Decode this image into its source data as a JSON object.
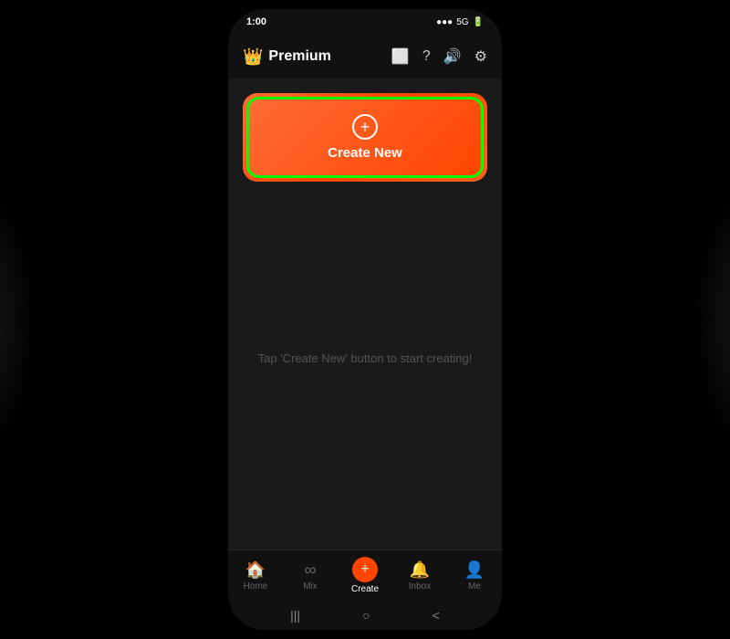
{
  "status_bar": {
    "time": "1:00",
    "right_info": "5G"
  },
  "header": {
    "crown_icon": "👑",
    "title": "Premium",
    "icons": {
      "monitor": "monitor-icon",
      "help": "help-icon",
      "volume": "volume-icon",
      "settings": "settings-icon"
    }
  },
  "create_button": {
    "label": "Create New",
    "plus_symbol": "+"
  },
  "empty_state": {
    "message": "Tap 'Create New' button to start creating!"
  },
  "bottom_nav": {
    "items": [
      {
        "label": "Home",
        "icon": "🏠",
        "active": false
      },
      {
        "label": "Mix",
        "icon": "∞",
        "active": false
      },
      {
        "label": "Create",
        "icon": "+",
        "active": true
      },
      {
        "label": "Inbox",
        "icon": "🔔",
        "active": false
      },
      {
        "label": "Me",
        "icon": "👤",
        "active": false
      }
    ]
  },
  "android_nav": {
    "menu_icon": "|||",
    "home_icon": "○",
    "back_icon": "<"
  }
}
